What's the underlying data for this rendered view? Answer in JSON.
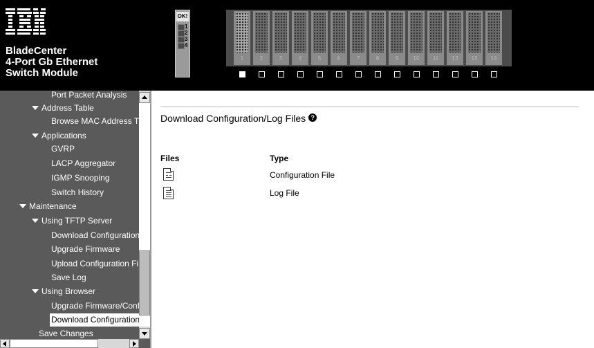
{
  "header": {
    "logo_text": "IBM.",
    "product_lines": [
      "BladeCenter",
      "4-Port Gb Ethernet",
      "Switch Module"
    ],
    "ok_label": "OK!",
    "module_ports": [
      "1",
      "2",
      "3",
      "4"
    ],
    "bay_numbers": [
      "1",
      "2",
      "3",
      "4",
      "5",
      "6",
      "7",
      "8",
      "9",
      "10",
      "11",
      "12",
      "13",
      "14"
    ],
    "selected_bay": "1"
  },
  "sidebar": {
    "items": [
      {
        "label": "Port Packet Analysis",
        "expanded": false
      },
      {
        "label": "Address Table",
        "expanded": true
      },
      {
        "label": "Browse MAC Address T",
        "expanded": false
      },
      {
        "label": "Applications",
        "expanded": true
      },
      {
        "label": "GVRP",
        "expanded": false
      },
      {
        "label": "LACP Aggregator",
        "expanded": false
      },
      {
        "label": "IGMP Snooping",
        "expanded": false
      },
      {
        "label": "Switch History",
        "expanded": false
      },
      {
        "label": "Maintenance",
        "expanded": true
      },
      {
        "label": "Using TFTP Server",
        "expanded": true
      },
      {
        "label": "Download Configuration",
        "expanded": false
      },
      {
        "label": "Upgrade Firmware",
        "expanded": false
      },
      {
        "label": "Upload Configuration Fi",
        "expanded": false
      },
      {
        "label": "Save Log",
        "expanded": false
      },
      {
        "label": "Using Browser",
        "expanded": true
      },
      {
        "label": "Upgrade Firmware/Conf",
        "expanded": false
      },
      {
        "label": "Download Configuration",
        "expanded": false,
        "active": true
      },
      {
        "label": "Save Changes",
        "expanded": false
      }
    ]
  },
  "main": {
    "title": "Download Configuration/Log Files",
    "help_icon": "question-icon",
    "columns": {
      "files": "Files",
      "type": "Type"
    },
    "rows": [
      {
        "icon": "config-file-icon",
        "type": "Configuration File"
      },
      {
        "icon": "log-file-icon",
        "type": "Log File"
      }
    ]
  }
}
